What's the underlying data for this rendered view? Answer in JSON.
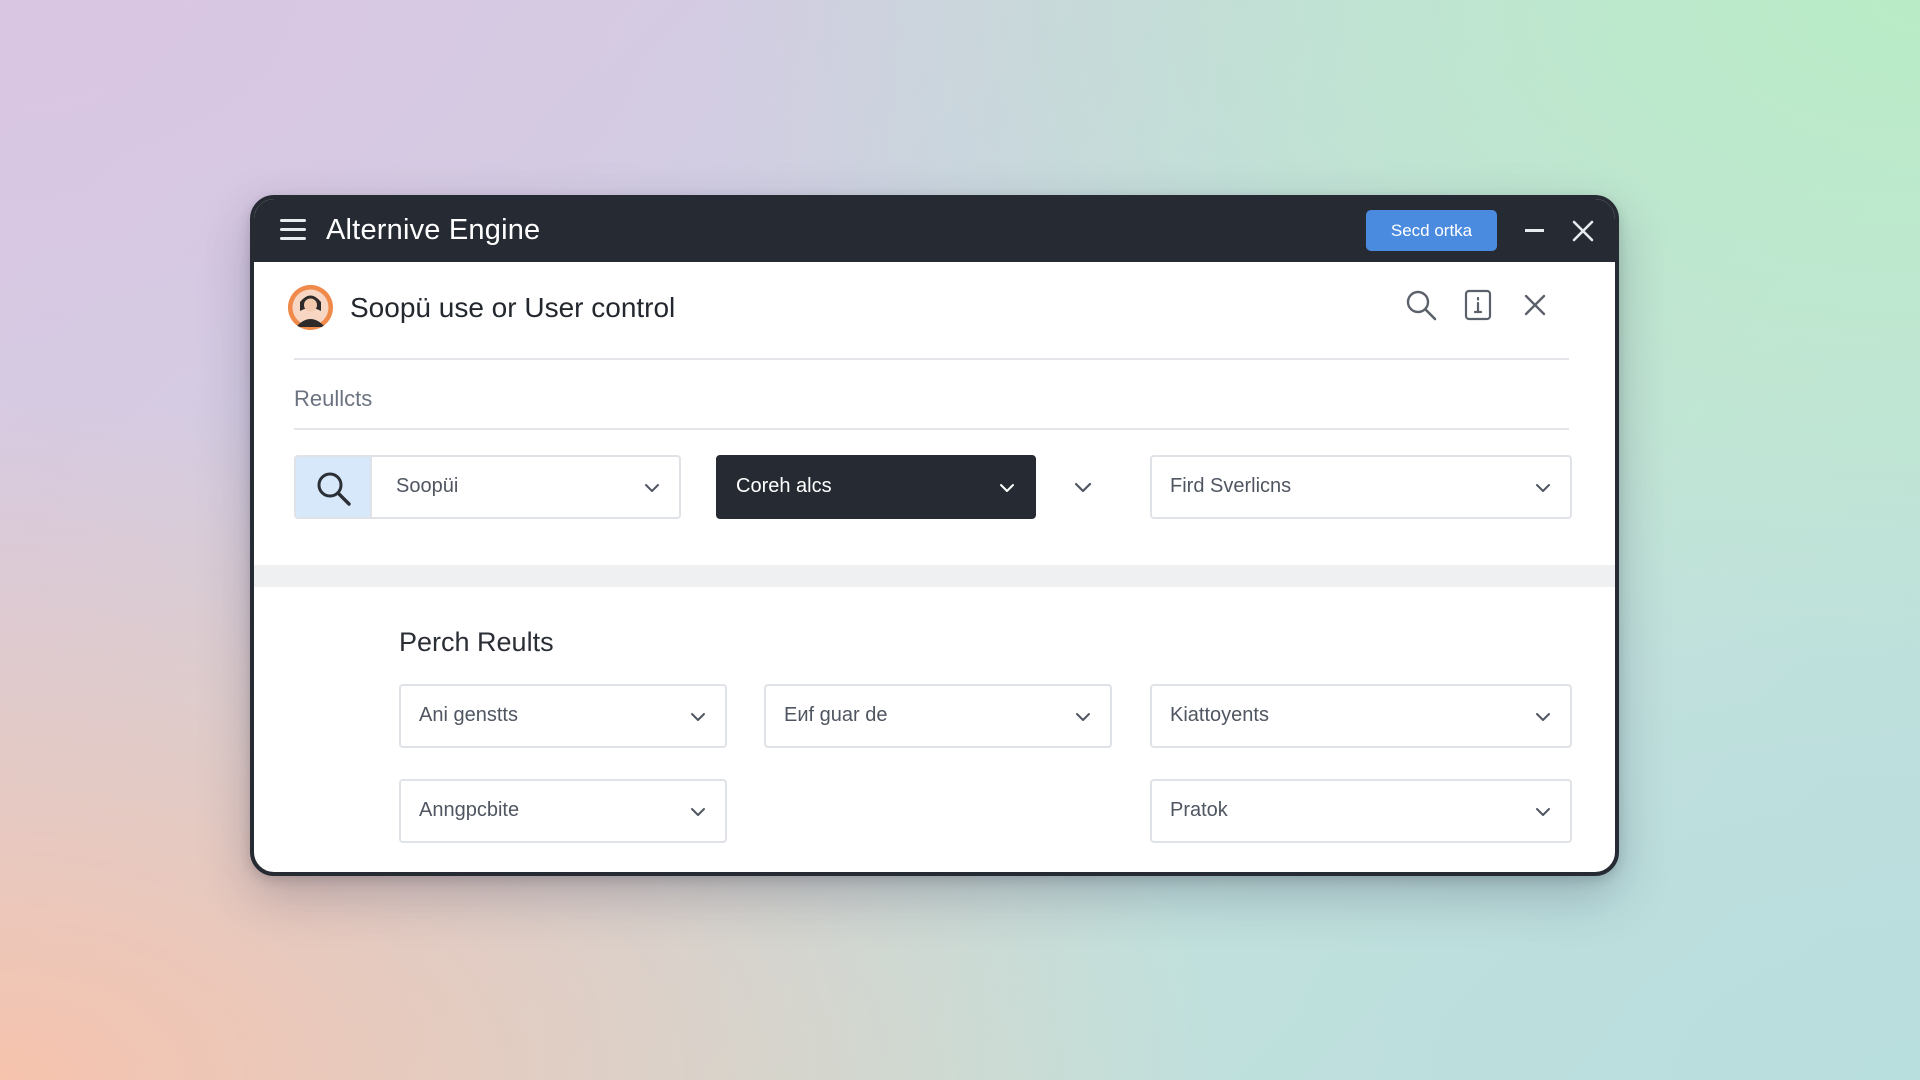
{
  "window": {
    "title": "Alternive Engine",
    "primary_action_label": "Secd ortka"
  },
  "header": {
    "title": "Soopü use or User control",
    "icons": [
      "search-icon",
      "document-icon",
      "close-icon"
    ]
  },
  "filters": {
    "section_label": "Reullcts",
    "search_select": {
      "value": "Soopüi"
    },
    "dark_select": {
      "value": "Coreh alcs"
    },
    "third_select": {
      "value": "Fird Sverlicns"
    }
  },
  "results": {
    "title": "Perch Reults",
    "dropdowns": [
      {
        "value": "Ani genstts"
      },
      {
        "value": "Eиf guar de"
      },
      {
        "value": "Kiattoyents"
      },
      {
        "value": "Anngpcbite"
      },
      {
        "value": "Pratok"
      }
    ]
  },
  "colors": {
    "titlebar": "#262b33",
    "accent": "#4a8be0",
    "search_button_bg": "#d8e8fb",
    "dark_select_bg": "#262b33"
  }
}
